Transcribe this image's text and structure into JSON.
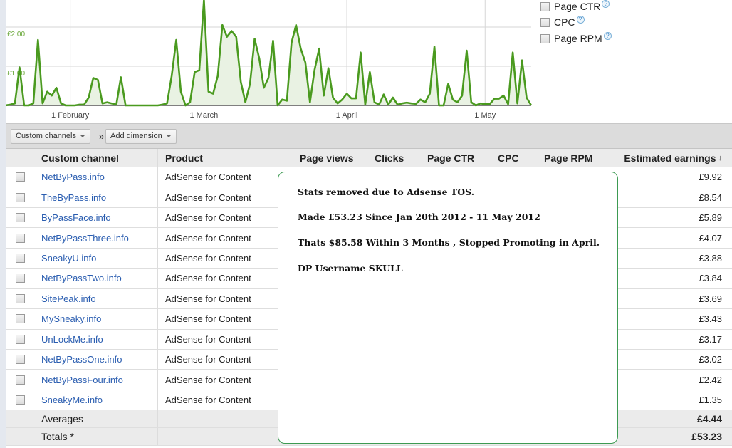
{
  "chart_data": {
    "type": "area",
    "title": "",
    "ylabel": "Estimated earnings",
    "ytick_labels": [
      "£1.00",
      "£2.00"
    ],
    "yticks": [
      1,
      2
    ],
    "ylim": [
      0,
      2.69
    ],
    "xlim": [
      0,
      114
    ],
    "xtick_labels": [
      "1 February",
      "1 March",
      "1 April",
      "1 May"
    ],
    "xticks": [
      14,
      43,
      74,
      104
    ],
    "grid": true,
    "color": "#4a9a1f",
    "fill": "#e9f2e3",
    "values": [
      0,
      0.02,
      0.05,
      0.97,
      0,
      0,
      0.05,
      1.67,
      0.05,
      0.35,
      0.25,
      0.45,
      0.05,
      0,
      0,
      0,
      0.02,
      0.02,
      0.2,
      0.7,
      0.65,
      0.05,
      0.08,
      0.05,
      0.02,
      0.72,
      0,
      0,
      0,
      0,
      0,
      0,
      0,
      0,
      0.02,
      0.05,
      0.75,
      1.67,
      0.35,
      0,
      0.08,
      0.85,
      0.9,
      2.69,
      0.35,
      0.3,
      0.75,
      2.05,
      1.75,
      1.9,
      1.75,
      0.6,
      0.08,
      0.55,
      1.7,
      1.2,
      0.45,
      0.7,
      1.65,
      0,
      0.15,
      0.12,
      1.6,
      2.05,
      1.45,
      1.1,
      0.08,
      0.9,
      1.45,
      0.25,
      0.95,
      0.2,
      0.05,
      0.15,
      0.3,
      0.18,
      0.18,
      1.35,
      0.02,
      0.85,
      0.08,
      0.02,
      0.28,
      0.02,
      0.2,
      0.02,
      0.05,
      0.07,
      0.05,
      0.04,
      0.15,
      0.08,
      0.3,
      1.5,
      0,
      0,
      0.55,
      0.15,
      0.08,
      0.25,
      1.4,
      0.08,
      0,
      0.05,
      0.03,
      0.03,
      0.17,
      0.17,
      0.25,
      0.03,
      1.35,
      0.05,
      1.15,
      0.2,
      0
    ]
  },
  "metrics": [
    {
      "label": "Page CTR"
    },
    {
      "label": "CPC"
    },
    {
      "label": "Page RPM"
    }
  ],
  "help_glyph": "?",
  "toolbar": {
    "dimension": "Custom channels",
    "separator": "»",
    "add_dimension": "Add dimension"
  },
  "table": {
    "headers": {
      "channel": "Custom channel",
      "product": "Product",
      "page_views": "Page views",
      "clicks": "Clicks",
      "page_ctr": "Page CTR",
      "cpc": "CPC",
      "page_rpm": "Page RPM",
      "earnings": "Estimated earnings",
      "sort_arrow": "↓"
    },
    "rows": [
      {
        "channel": "NetByPass.info",
        "product": "AdSense for Content",
        "earnings": "£9.92"
      },
      {
        "channel": "TheByPass.info",
        "product": "AdSense for Content",
        "earnings": "£8.54"
      },
      {
        "channel": "ByPassFace.info",
        "product": "AdSense for Content",
        "earnings": "£5.89"
      },
      {
        "channel": "NetByPassThree.info",
        "product": "AdSense for Content",
        "earnings": "£4.07"
      },
      {
        "channel": "SneakyU.info",
        "product": "AdSense for Content",
        "earnings": "£3.88"
      },
      {
        "channel": "NetByPassTwo.info",
        "product": "AdSense for Content",
        "earnings": "£3.84"
      },
      {
        "channel": "SitePeak.info",
        "product": "AdSense for Content",
        "earnings": "£3.69"
      },
      {
        "channel": "MySneaky.info",
        "product": "AdSense for Content",
        "earnings": "£3.43"
      },
      {
        "channel": "UnLockMe.info",
        "product": "AdSense for Content",
        "earnings": "£3.17"
      },
      {
        "channel": "NetByPassOne.info",
        "product": "AdSense for Content",
        "earnings": "£3.02"
      },
      {
        "channel": "NetByPassFour.info",
        "product": "AdSense for Content",
        "earnings": "£2.42"
      },
      {
        "channel": "SneakyMe.info",
        "product": "AdSense for Content",
        "earnings": "£1.35"
      }
    ],
    "averages": {
      "label": "Averages",
      "earnings": "£4.44"
    },
    "totals": {
      "label": "Totals *",
      "earnings": "£53.23"
    }
  },
  "overlay": {
    "lines": [
      "Stats removed due to Adsense TOS.",
      "Made £53.23 Since Jan 20th 2012 - 11 May 2012",
      "Thats $85.58 Within 3 Months , Stopped Promoting in April.",
      "DP Username SKULL"
    ]
  }
}
